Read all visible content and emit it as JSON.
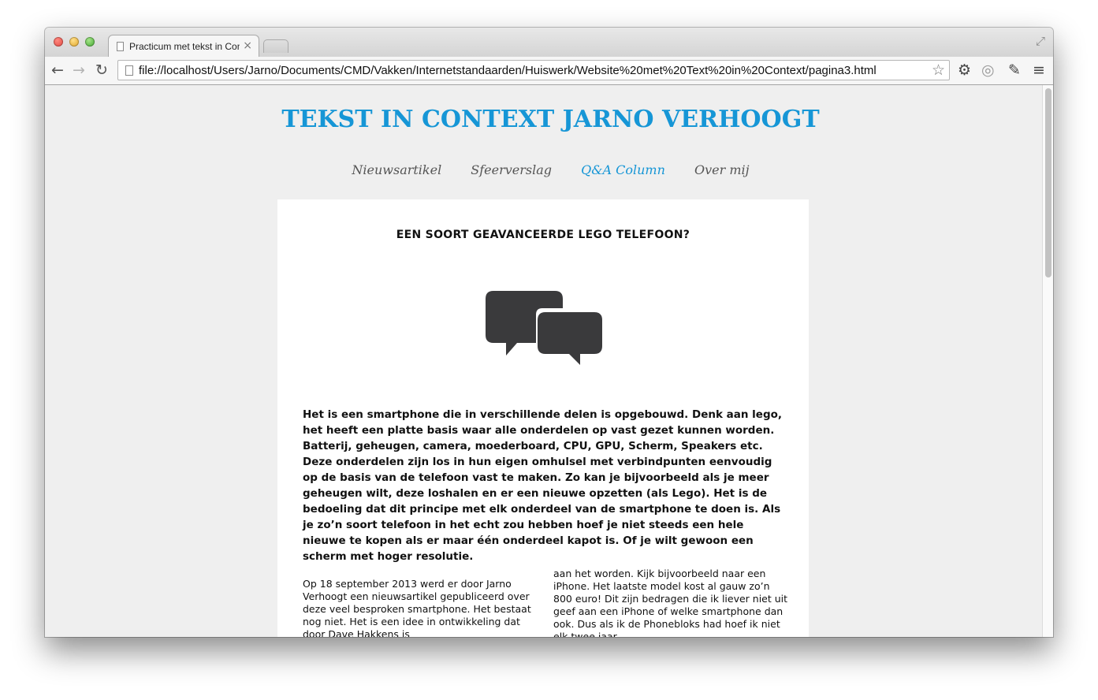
{
  "browser": {
    "tab_title": "Practicum met tekst in Context",
    "tab_close": "×",
    "url": "file://localhost/Users/Jarno/Documents/CMD/Vakken/Internetstandaarden/Huiswerk/Website%20met%20Text%20in%20Context/pagina3.html",
    "icons": {
      "back": "←",
      "forward": "→",
      "reload": "↻",
      "bookmark": "☆",
      "settings": "⚙",
      "extension": "◎",
      "eyedropper": "✎",
      "menu": "≡",
      "fullscreen": "⤢"
    }
  },
  "site": {
    "title": "TEKST IN CONTEXT JARNO VERHOOGT",
    "nav": [
      "Nieuwsartikel",
      "Sfeerverslag",
      "Q&A Column",
      "Over mij"
    ],
    "active_nav_index": 2,
    "accent_color": "#1696d6"
  },
  "article": {
    "heading": "EEN SOORT GEAVANCEERDE LEGO TELEFOON?",
    "icon": "chat-bubbles-icon",
    "intro": "Het is een smartphone die in verschillende delen is opgebouwd. Denk aan lego, het heeft een platte basis waar alle onderdelen op vast gezet kunnen worden. Batterij, geheugen, camera, moederboard, CPU, GPU, Scherm, Speakers etc. Deze onderdelen zijn los in hun eigen omhulsel met verbindpunten eenvoudig op de basis van de telefoon vast te maken. Zo kan je bijvoorbeeld als je meer geheugen wilt, deze loshalen en er een nieuwe opzetten (als Lego). Het is de bedoeling dat dit principe met elk onderdeel van de smartphone te doen is. Als je zo’n soort telefoon in het echt zou hebben hoef je niet steeds een hele nieuwe te kopen als er maar één onderdeel kapot is. Of je wilt gewoon een scherm met hoger resolutie.",
    "column_left": "Op 18 september 2013 werd er door Jarno Verhoogt een nieuwsartikel gepubliceerd over deze veel besproken smartphone. Het bestaat nog niet. Het is een idee in ontwikkeling dat door Dave Hakkens is",
    "column_right": "aan het worden. Kijk bijvoorbeeld naar een iPhone. Het laatste model kost al gauw zo’n 800 euro! Dit zijn bedragen die ik liever niet uit geef aan een iPhone of welke smartphone dan ook. Dus als ik de Phonebloks had hoef ik niet elk twee jaar"
  }
}
